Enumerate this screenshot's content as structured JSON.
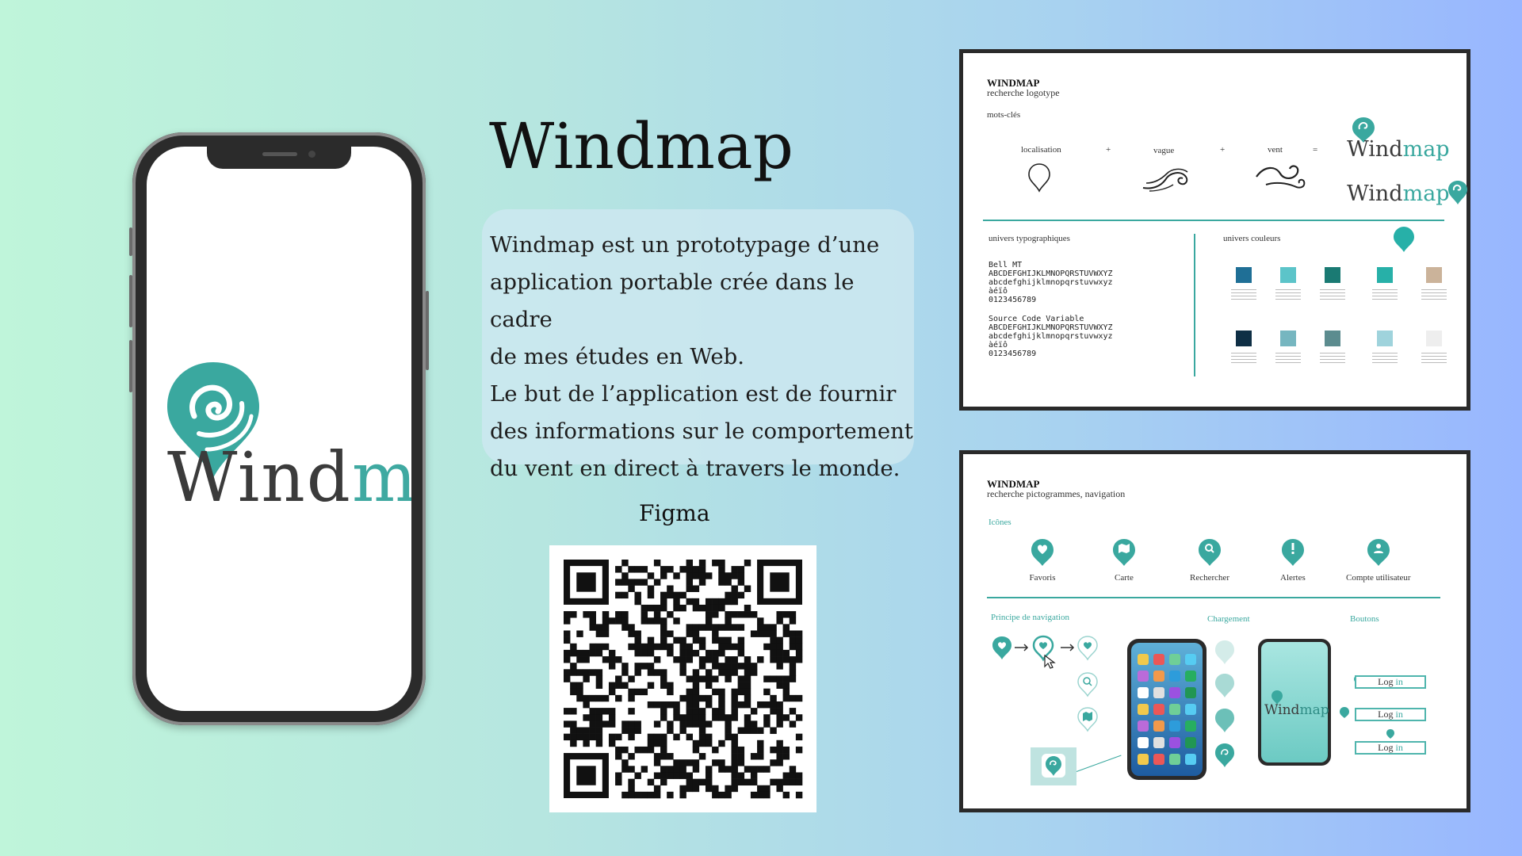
{
  "title": "Windmap",
  "description": {
    "lines": [
      "Windmap est un prototypage d’une",
      "application portable crée dans le cadre",
      "de mes études en Web.",
      "Le but de l’application  est de fournir",
      "des informations sur le comportement",
      "du vent en direct à travers le monde."
    ]
  },
  "figma_label": "Figma",
  "phone_logo": {
    "part1": "Wind",
    "part2": "map"
  },
  "colors": {
    "teal": "#3aa89f",
    "dark_text": "#3b3b3b",
    "background_left": "#bff5da",
    "background_right": "#98b6ff"
  },
  "card1": {
    "heading": "WINDMAP",
    "subheading": "recherche logotype",
    "keywords_label": "mots-clés",
    "keywords": [
      "localisation",
      "vague",
      "vent"
    ],
    "operators": [
      "+",
      "+",
      "="
    ],
    "logo_text": {
      "part1": "Wind",
      "part2": "map"
    },
    "typo_label": "univers typographiques",
    "font1": {
      "name": "Bell MT",
      "upper": "ABCDEFGHIJKLMNOPQRSTUVWXYZ",
      "lower": "abcdefghijklmnopqrstuvwxyz",
      "accents": "àéïô",
      "digits": "0123456789"
    },
    "font2": {
      "name": "Source Code Variable",
      "upper": "ABCDEFGHIJKLMNOPQRSTUVWXYZ",
      "lower": "abcdefghijklmnopqrstuvwxyz",
      "accents": "àéïô",
      "digits": "0123456789"
    },
    "colors_label": "univers couleurs",
    "palette_row1": [
      "#1f6f96",
      "#5cc4c9",
      "#1a7a73",
      "#27b0a8",
      "#cbb39a"
    ],
    "palette_row2": [
      "#0f2f45",
      "#76b6c0",
      "#5c8c8f",
      "#9fd3dc",
      "#eeeeee"
    ]
  },
  "card2": {
    "heading": "WINDMAP",
    "subheading": "recherche pictogrammes, navigation",
    "icons_label": "Icônes",
    "icons": [
      "Favoris",
      "Carte",
      "Rechercher",
      "Alertes",
      "Compte utilisateur"
    ],
    "nav_label": "Principe de navigation",
    "loading_label": "Chargement",
    "buttons_label": "Boutons",
    "login_buttons": [
      {
        "part1": "Log",
        "part2": "in"
      },
      {
        "part1": "Log",
        "part2": "in"
      },
      {
        "part1": "Log",
        "part2": "in"
      }
    ],
    "mini_logo": {
      "part1": "Wind",
      "part2": "map"
    }
  }
}
